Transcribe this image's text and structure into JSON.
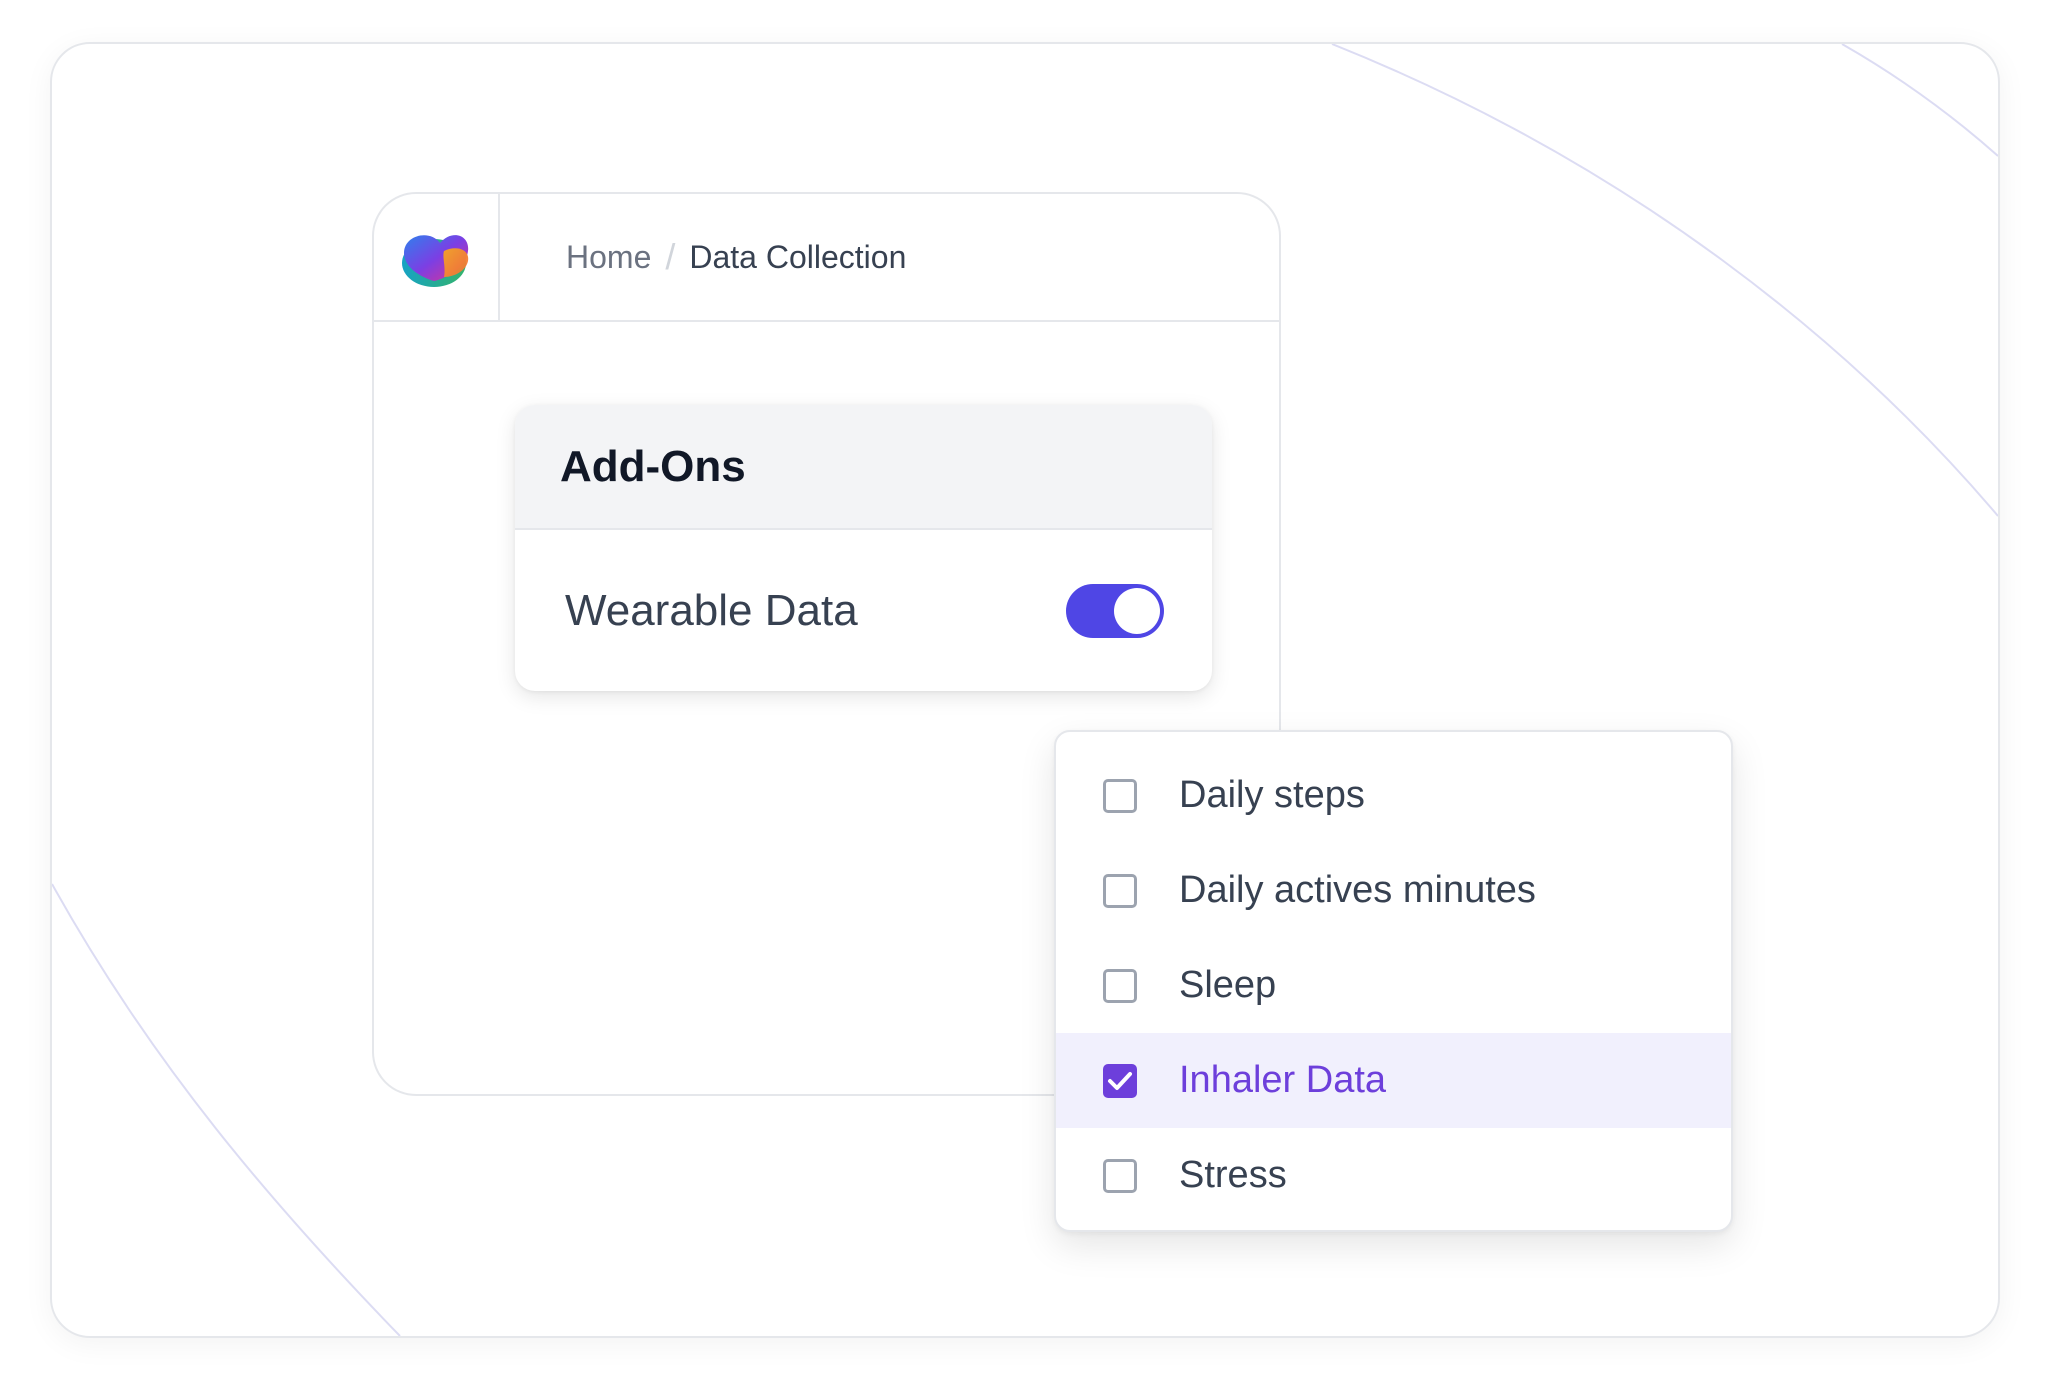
{
  "breadcrumb": {
    "home": "Home",
    "separator": "/",
    "current": "Data Collection"
  },
  "addons": {
    "title": "Add-Ons",
    "row_label": "Wearable Data",
    "toggle_on": true
  },
  "options": [
    {
      "label": "Daily steps",
      "checked": false
    },
    {
      "label": "Daily actives minutes",
      "checked": false
    },
    {
      "label": "Sleep",
      "checked": false
    },
    {
      "label": "Inhaler Data",
      "checked": true
    },
    {
      "label": "Stress",
      "checked": false
    }
  ],
  "colors": {
    "accent": "#4f46e5",
    "checked": "#6d3fdb",
    "selected_bg": "#f1f0fd",
    "arc": "#dcdcf3"
  }
}
